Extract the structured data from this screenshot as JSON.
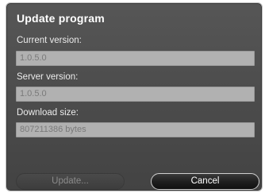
{
  "dialog": {
    "title": "Update program",
    "current_version_label": "Current version:",
    "current_version_value": "1.0.5.0",
    "server_version_label": "Server version:",
    "server_version_value": "1.0.5.0",
    "download_size_label": "Download size:",
    "download_size_value": "807211386 bytes",
    "update_button_label": "Update...",
    "cancel_button_label": "Cancel"
  }
}
